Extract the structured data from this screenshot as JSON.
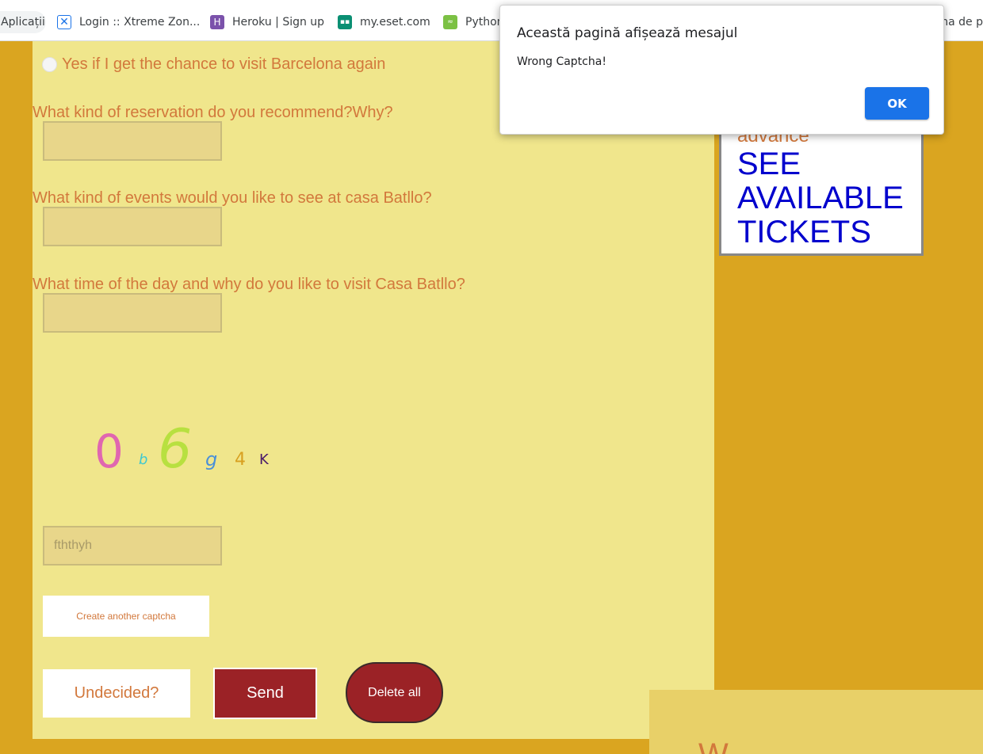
{
  "bookmarks": {
    "apps_label": "Aplicații",
    "items": [
      {
        "label": "Login :: Xtreme Zon...",
        "icon": "xtreme-icon"
      },
      {
        "label": "Heroku | Sign up",
        "icon": "heroku-icon"
      },
      {
        "label": "my.eset.com",
        "icon": "eset-icon"
      },
      {
        "label": "Python",
        "icon": "python-icon"
      }
    ],
    "cut_right": "ina de p"
  },
  "form": {
    "radio_option": "Yes if I get the chance to visit Barcelona again",
    "q_reservation": "What kind of reservation do you recommend?Why?",
    "q_events": "What kind of events would you like to see at casa Batllo?",
    "q_time": "What time of the day and why do you like to visit Casa Batllo?",
    "captcha_chars": [
      "0",
      "b",
      "6",
      "g",
      "4",
      "K"
    ],
    "captcha_input_value": "fththyh",
    "create_captcha_label": "Create another captcha",
    "undecided_label": "Undecided?",
    "send_label": "Send",
    "delete_label": "Delete all"
  },
  "tickets": {
    "advance_text": "advance",
    "see_tickets": "SEE AVAILABLE TICKETS"
  },
  "bottom_right": {
    "partial_text": "W"
  },
  "dialog": {
    "title": "Această pagină afișează mesajul",
    "message": "Wrong Captcha!",
    "ok_label": "OK"
  },
  "colors": {
    "page_bg": "#daa520",
    "panel_bg": "#f0e68c",
    "text_orange": "#d2783c",
    "send_red": "#9b2226",
    "ticket_blue": "#0000cd",
    "dialog_ok": "#1a73e8"
  }
}
